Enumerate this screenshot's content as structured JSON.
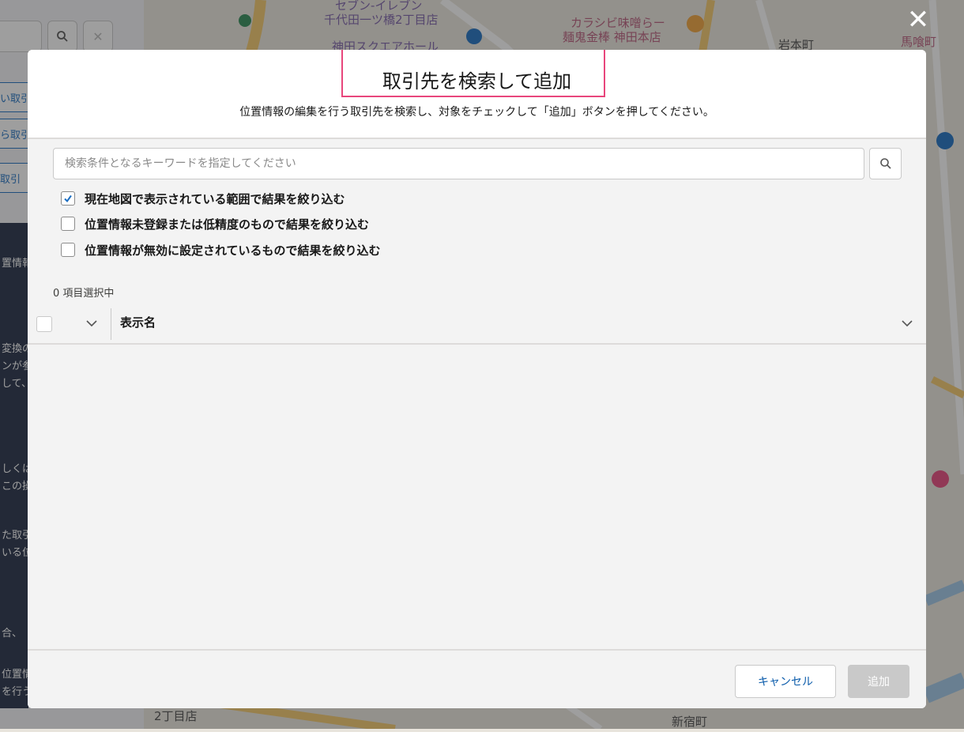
{
  "map": {
    "labels": [
      {
        "text": "セブン-イレブン",
        "cls": "purple"
      },
      {
        "text": "千代田一ツ橋2丁目店",
        "cls": "purple"
      },
      {
        "text": "神田スクエアホール",
        "cls": "purple"
      },
      {
        "text": "カラシビ味噌らー",
        "cls": "pink"
      },
      {
        "text": "麺鬼金棒 神田本店",
        "cls": "pink"
      },
      {
        "text": "岩本町",
        "cls": ""
      },
      {
        "text": "馬喰町",
        "cls": ""
      },
      {
        "text": "2丁目店",
        "cls": ""
      },
      {
        "text": "新宿町",
        "cls": ""
      }
    ]
  },
  "left_panel": {
    "tabs": [
      "い取引",
      "ら取引",
      "取引"
    ],
    "dark_texts": [
      "置情報",
      "変換の",
      "ンが参",
      "して、",
      "しくは",
      "この操",
      "た取引",
      "いる位",
      "合、",
      "位置情",
      "を行う"
    ]
  },
  "modal": {
    "close_glyph": "✕",
    "title": "取引先を検索して追加",
    "subtitle": "位置情報の編集を行う取引先を検索し、対象をチェックして「追加」ボタンを押してください。",
    "search": {
      "placeholder": "検索条件となるキーワードを指定してください",
      "value": ""
    },
    "filters": [
      {
        "label": "現在地図で表示されている範囲で結果を絞り込む",
        "checked": true
      },
      {
        "label": "位置情報未登録または低精度のもので結果を絞り込む",
        "checked": false
      },
      {
        "label": "位置情報が無効に設定されているもので結果を絞り込む",
        "checked": false
      }
    ],
    "selected_count_text": "0 項目選択中",
    "table": {
      "column_name": "表示名",
      "rows": []
    },
    "footer": {
      "cancel_label": "キャンセル",
      "add_label": "追加"
    }
  },
  "colors": {
    "highlight": "#e8467c",
    "link_blue": "#0b5cab",
    "check_blue": "#1b6ec2",
    "disabled_gray": "#c9c9c9"
  }
}
